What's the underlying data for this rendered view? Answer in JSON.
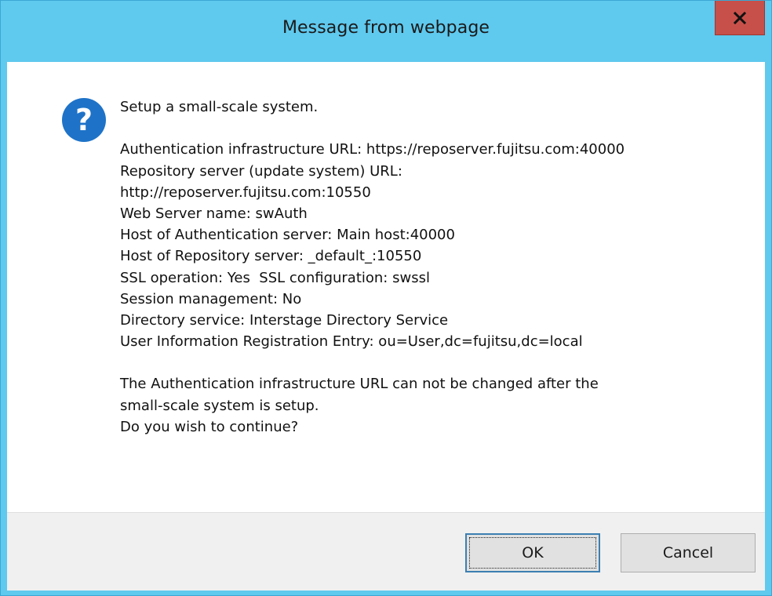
{
  "window": {
    "title": "Message from webpage",
    "close_label": "x"
  },
  "icon": {
    "name": "question-icon",
    "glyph": "?",
    "color": "#1e73c8"
  },
  "message": {
    "lines": [
      "Setup a small-scale system.",
      "",
      "Authentication infrastructure URL: https://reposerver.fujitsu.com:40000",
      "Repository server (update system) URL:",
      "http://reposerver.fujitsu.com:10550",
      "Web Server name: swAuth",
      "Host of Authentication server: Main host:40000",
      "Host of Repository server: _default_:10550",
      "SSL operation: Yes  SSL configuration: swssl",
      "Session management: No",
      "Directory service: Interstage Directory Service",
      "User Information Registration Entry: ou=User,dc=fujitsu,dc=local",
      "",
      "The Authentication infrastructure URL can not be changed after the",
      "small-scale system is setup.",
      "Do you wish to continue?"
    ]
  },
  "buttons": {
    "ok_label": "OK",
    "cancel_label": "Cancel"
  },
  "colors": {
    "titlebar": "#5fc9ee",
    "close_button": "#c7504a",
    "footer": "#f0f0f0"
  }
}
